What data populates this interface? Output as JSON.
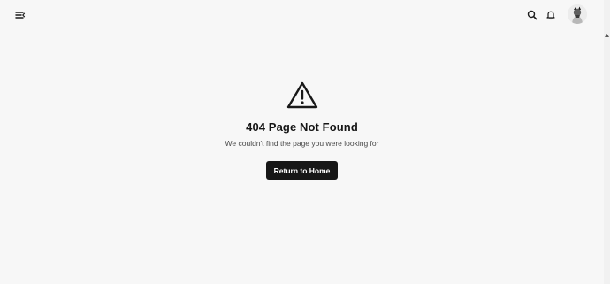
{
  "header": {
    "menu_icon": "menu-collapse-icon",
    "search_icon": "search-icon",
    "notification_icon": "bell-icon",
    "avatar_icon": "user-avatar"
  },
  "error": {
    "icon": "warning-triangle-icon",
    "title": "404 Page Not Found",
    "message": "We couldn't find the page you were looking for",
    "button_label": "Return to Home"
  },
  "colors": {
    "background": "#f7f7f7",
    "text_primary": "#151515",
    "text_secondary": "#4a4a4a",
    "button_bg": "#171717",
    "button_text": "#ffffff"
  },
  "scrollbar": {
    "up_icon": "scroll-up-arrow-icon"
  }
}
